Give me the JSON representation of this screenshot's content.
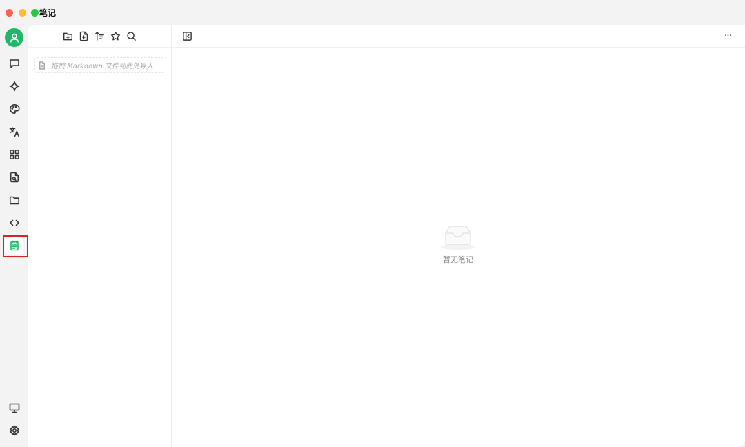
{
  "window": {
    "title": "笔记"
  },
  "sidebar": {
    "items": [
      {
        "name": "chat",
        "icon": "chat-bubble-icon"
      },
      {
        "name": "assistant",
        "icon": "sparkle-icon"
      },
      {
        "name": "paint",
        "icon": "palette-icon"
      },
      {
        "name": "translate",
        "icon": "translate-icon"
      },
      {
        "name": "apps",
        "icon": "grid-icon"
      },
      {
        "name": "files",
        "icon": "file-search-icon"
      },
      {
        "name": "folder",
        "icon": "folder-icon"
      },
      {
        "name": "code",
        "icon": "code-icon"
      },
      {
        "name": "notes",
        "icon": "notepad-icon",
        "active": true
      }
    ],
    "bottom": [
      {
        "name": "display",
        "icon": "monitor-icon"
      },
      {
        "name": "settings",
        "icon": "gear-icon"
      }
    ],
    "accent_color": "#1fb768",
    "highlight_color": "#e02020"
  },
  "list_panel": {
    "toolbar": [
      "new-folder-icon",
      "new-note-icon",
      "sort-icon",
      "star-icon",
      "search-icon"
    ],
    "drop_zone_text": "拖拽 Markdown 文件到此处导入"
  },
  "main": {
    "empty_text": "暂无笔记",
    "more_label": "···"
  }
}
